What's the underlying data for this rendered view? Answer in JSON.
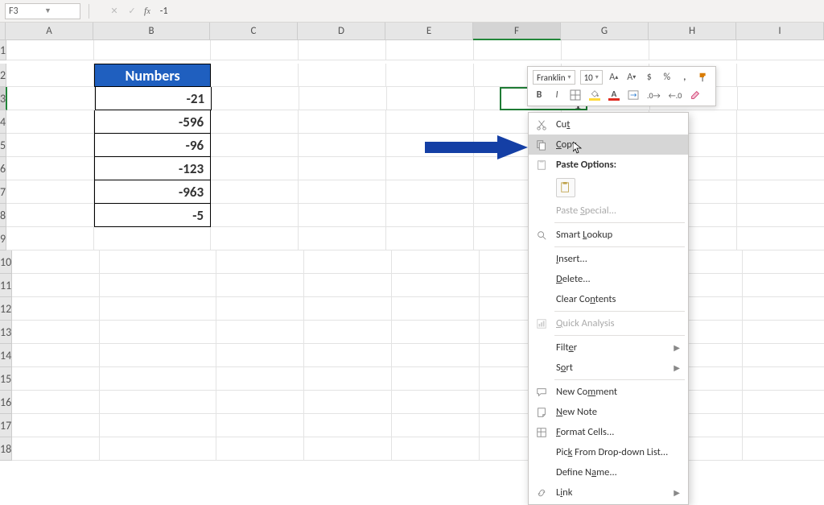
{
  "name_box": "F3",
  "formula_bar": "-1",
  "columns": [
    "A",
    "B",
    "C",
    "D",
    "E",
    "F",
    "G",
    "H",
    "I"
  ],
  "row_count": 18,
  "active_cell": {
    "col": "F",
    "row": 3,
    "value": "1"
  },
  "table": {
    "header": "Numbers",
    "values": [
      "-21",
      "-596",
      "-96",
      "-123",
      "-963",
      "-5"
    ]
  },
  "mini_toolbar": {
    "font": "Franklin",
    "size": "10"
  },
  "context_menu": {
    "cut": "Cut",
    "copy": "Copy",
    "paste_options": "Paste Options:",
    "paste_special": "Paste Special...",
    "smart_lookup": "Smart Lookup",
    "insert": "Insert...",
    "delete": "Delete...",
    "clear": "Clear Contents",
    "quick_analysis": "Quick Analysis",
    "filter": "Filter",
    "sort": "Sort",
    "new_comment": "New Comment",
    "new_note": "New Note",
    "format_cells": "Format Cells...",
    "pick_list": "Pick From Drop-down List...",
    "define_name": "Define Name...",
    "link": "Link"
  },
  "chart_data": {
    "type": "table",
    "title": "Numbers",
    "categories": [
      "B3",
      "B4",
      "B5",
      "B6",
      "B7",
      "B8"
    ],
    "values": [
      -21,
      -596,
      -96,
      -123,
      -963,
      -5
    ]
  }
}
